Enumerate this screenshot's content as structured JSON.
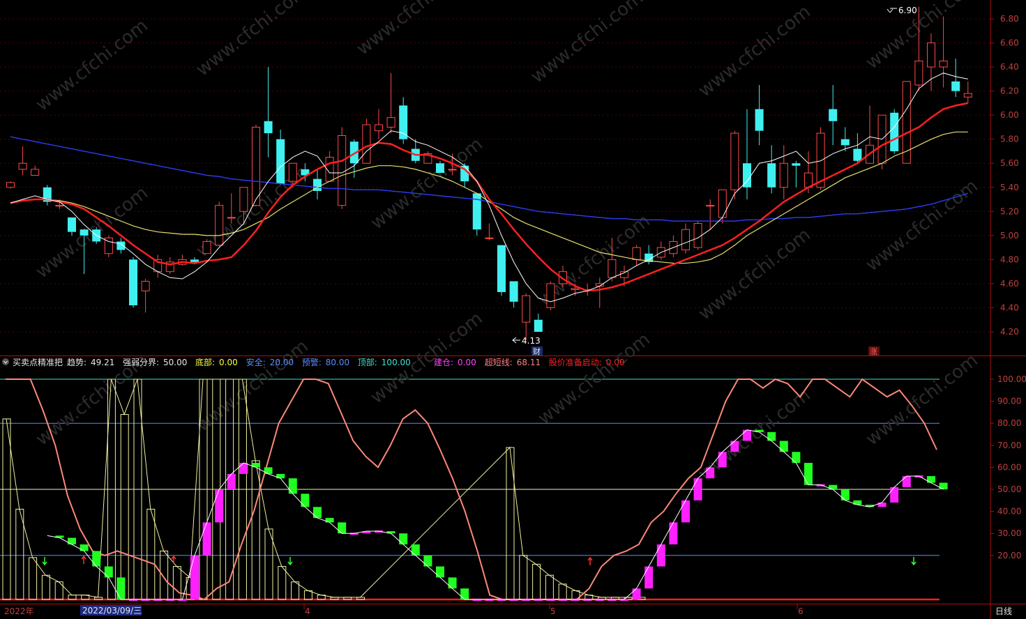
{
  "upper": {
    "y_ticks": [
      "6.80",
      "6.60",
      "6.40",
      "6.20",
      "6.00",
      "5.80",
      "5.60",
      "5.40",
      "5.20",
      "5.00",
      "4.80",
      "4.60",
      "4.40",
      "4.20"
    ],
    "high_label": "6.90",
    "low_label": "4.13",
    "marker_cai": "财",
    "marker_zhang": "涨"
  },
  "indicator": {
    "name": "买卖点精准把",
    "items": [
      {
        "label": "趋势:",
        "value": "49.21",
        "color": "#e8e8e8"
      },
      {
        "label": "强弱分界:",
        "value": "50.00",
        "color": "#e8e8e8"
      },
      {
        "label": "底部:",
        "value": "0.00",
        "color": "#ffff40"
      },
      {
        "label": "安全:",
        "value": "20.00",
        "color": "#5b8cff"
      },
      {
        "label": "预警:",
        "value": "80.00",
        "color": "#5b8cff"
      },
      {
        "label": "顶部:",
        "value": "100.00",
        "color": "#40e0d0"
      },
      {
        "label": "建仓:",
        "value": "0.00",
        "color": "#ff40ff"
      },
      {
        "label": "超短线:",
        "value": "68.11",
        "color": "#ff8080"
      },
      {
        "label": "股价准备启动:",
        "value": "0.00",
        "color": "#ff2020"
      }
    ],
    "y_ticks": [
      "100.00",
      "90.00",
      "80.00",
      "70.00",
      "60.00",
      "50.00",
      "40.00",
      "30.00",
      "20.00"
    ]
  },
  "x_axis": {
    "labels": [
      "2022年",
      "4",
      "5",
      "6"
    ],
    "cursor_date": "2022/03/09/三",
    "period": "日线"
  },
  "chart_data": {
    "type": "candlestick",
    "price_ylim": [
      4.1,
      6.9
    ],
    "indicator_ylim": [
      0,
      100
    ],
    "candles": [
      [
        5.4,
        5.44,
        5.39,
        5.45
      ],
      [
        5.55,
        5.6,
        5.5,
        5.74
      ],
      [
        5.5,
        5.55,
        5.5,
        5.58
      ],
      [
        5.4,
        5.28,
        5.25,
        5.42
      ],
      [
        5.25,
        5.25,
        5.22,
        5.3
      ],
      [
        5.15,
        5.03,
        5.0,
        5.15
      ],
      [
        5.05,
        5.0,
        4.68,
        5.05
      ],
      [
        5.05,
        4.95,
        4.93,
        5.07
      ],
      [
        4.85,
        4.98,
        4.82,
        5.0
      ],
      [
        4.95,
        4.88,
        4.85,
        4.98
      ],
      [
        4.8,
        4.42,
        4.4,
        4.82
      ],
      [
        4.54,
        4.62,
        4.36,
        4.64
      ],
      [
        4.7,
        4.8,
        4.65,
        4.84
      ],
      [
        4.7,
        4.78,
        4.68,
        4.82
      ],
      [
        4.76,
        4.8,
        4.75,
        4.84
      ],
      [
        4.8,
        4.78,
        4.76,
        4.82
      ],
      [
        4.85,
        4.95,
        4.85,
        4.97
      ],
      [
        4.92,
        5.25,
        4.91,
        5.28
      ],
      [
        5.15,
        5.15,
        5.1,
        5.35
      ],
      [
        5.2,
        5.4,
        5.1,
        5.4
      ],
      [
        5.25,
        5.9,
        5.24,
        5.92
      ],
      [
        5.95,
        5.85,
        5.65,
        6.4
      ],
      [
        5.8,
        5.43,
        5.42,
        5.88
      ],
      [
        5.45,
        5.6,
        5.4,
        5.6
      ],
      [
        5.55,
        5.5,
        5.45,
        5.6
      ],
      [
        5.47,
        5.37,
        5.3,
        5.55
      ],
      [
        5.45,
        5.65,
        5.45,
        5.7
      ],
      [
        5.25,
        5.83,
        5.22,
        5.9
      ],
      [
        5.78,
        5.6,
        5.48,
        5.8
      ],
      [
        5.6,
        5.92,
        5.6,
        5.97
      ],
      [
        5.87,
        5.92,
        5.8,
        6.05
      ],
      [
        5.9,
        5.98,
        5.85,
        6.35
      ],
      [
        6.08,
        5.8,
        5.76,
        6.15
      ],
      [
        5.72,
        5.62,
        5.6,
        5.8
      ],
      [
        5.6,
        5.68,
        5.6,
        5.7
      ],
      [
        5.6,
        5.52,
        5.52,
        5.62
      ],
      [
        5.55,
        5.55,
        5.5,
        5.68
      ],
      [
        5.58,
        5.45,
        5.4,
        5.6
      ],
      [
        5.35,
        5.05,
        5.0,
        5.35
      ],
      [
        4.98,
        4.98,
        4.96,
        5.1
      ],
      [
        4.92,
        4.53,
        4.5,
        4.92
      ],
      [
        4.62,
        4.45,
        4.4,
        4.62
      ],
      [
        4.28,
        4.5,
        4.13,
        4.52
      ],
      [
        4.3,
        4.2,
        4.2,
        4.35
      ],
      [
        4.4,
        4.6,
        4.38,
        4.62
      ],
      [
        4.6,
        4.7,
        4.57,
        4.75
      ],
      [
        4.55,
        4.56,
        4.5,
        4.6
      ],
      [
        4.55,
        4.55,
        4.5,
        4.6
      ],
      [
        4.58,
        4.6,
        4.4,
        4.65
      ],
      [
        4.65,
        4.8,
        4.62,
        4.98
      ],
      [
        4.65,
        4.7,
        4.58,
        4.75
      ],
      [
        4.8,
        4.9,
        4.75,
        4.92
      ],
      [
        4.85,
        4.78,
        4.76,
        4.92
      ],
      [
        4.82,
        4.9,
        4.8,
        4.95
      ],
      [
        4.85,
        4.95,
        4.82,
        5.0
      ],
      [
        4.88,
        5.05,
        4.85,
        5.1
      ],
      [
        4.9,
        5.1,
        4.88,
        5.12
      ],
      [
        5.25,
        5.25,
        5.05,
        5.3
      ],
      [
        5.15,
        5.38,
        5.1,
        5.38
      ],
      [
        5.38,
        5.85,
        5.3,
        5.87
      ],
      [
        5.6,
        5.4,
        5.3,
        6.05
      ],
      [
        6.05,
        5.87,
        5.75,
        6.25
      ],
      [
        5.6,
        5.4,
        5.35,
        5.75
      ],
      [
        5.4,
        5.6,
        5.3,
        5.75
      ],
      [
        5.6,
        5.58,
        5.4,
        5.62
      ],
      [
        5.4,
        5.52,
        5.35,
        5.7
      ],
      [
        5.4,
        5.85,
        5.38,
        5.9
      ],
      [
        6.05,
        5.95,
        5.75,
        6.25
      ],
      [
        5.8,
        5.75,
        5.7,
        5.9
      ],
      [
        5.72,
        5.62,
        5.6,
        5.85
      ],
      [
        5.6,
        5.75,
        5.6,
        6.08
      ],
      [
        5.6,
        6.0,
        5.55,
        6.0
      ],
      [
        6.02,
        5.7,
        5.68,
        6.05
      ],
      [
        5.6,
        6.28,
        5.6,
        6.28
      ],
      [
        6.25,
        6.45,
        6.2,
        6.9
      ],
      [
        6.4,
        6.6,
        6.2,
        6.68
      ],
      [
        6.4,
        6.45,
        6.23,
        6.82
      ],
      [
        6.28,
        6.2,
        6.15,
        6.47
      ],
      [
        6.15,
        6.18,
        6.1,
        6.28
      ]
    ],
    "ma_short": [
      5.27,
      5.3,
      5.33,
      5.3,
      5.28,
      5.2,
      5.09,
      5.0,
      4.95,
      4.93,
      4.85,
      4.76,
      4.7,
      4.65,
      4.64,
      4.7,
      4.78,
      4.9,
      5.0,
      5.1,
      5.3,
      5.45,
      5.57,
      5.65,
      5.7,
      5.66,
      5.52,
      5.52,
      5.58,
      5.7,
      5.78,
      5.87,
      5.85,
      5.78,
      5.75,
      5.7,
      5.65,
      5.58,
      5.45,
      5.25,
      5.0,
      4.78,
      4.6,
      4.48,
      4.45,
      4.48,
      4.52,
      4.54,
      4.58,
      4.65,
      4.69,
      4.75,
      4.8,
      4.86,
      4.9,
      4.94,
      4.98,
      5.05,
      5.15,
      5.35,
      5.45,
      5.6,
      5.62,
      5.66,
      5.7,
      5.6,
      5.62,
      5.68,
      5.72,
      5.75,
      5.82,
      5.8,
      5.9,
      6.05,
      6.22,
      6.3,
      6.35,
      6.32,
      6.3
    ],
    "ma_mid": [
      5.27,
      5.29,
      5.3,
      5.3,
      5.28,
      5.26,
      5.22,
      5.15,
      5.08,
      5.0,
      4.92,
      4.85,
      4.78,
      4.76,
      4.78,
      4.77,
      4.79,
      4.8,
      4.82,
      4.92,
      5.04,
      5.19,
      5.32,
      5.42,
      5.49,
      5.55,
      5.6,
      5.62,
      5.68,
      5.74,
      5.77,
      5.76,
      5.71,
      5.67,
      5.67,
      5.64,
      5.6,
      5.55,
      5.45,
      5.3,
      5.18,
      5.05,
      4.93,
      4.82,
      4.72,
      4.64,
      4.58,
      4.54,
      4.55,
      4.57,
      4.6,
      4.64,
      4.68,
      4.72,
      4.76,
      4.8,
      4.84,
      4.88,
      4.92,
      4.98,
      5.05,
      5.12,
      5.2,
      5.28,
      5.34,
      5.4,
      5.45,
      5.5,
      5.55,
      5.6,
      5.68,
      5.75,
      5.8,
      5.85,
      5.9,
      5.98,
      6.05,
      6.08,
      6.1
    ],
    "ma_long": [
      5.27,
      5.29,
      5.3,
      5.3,
      5.29,
      5.27,
      5.24,
      5.2,
      5.16,
      5.12,
      5.08,
      5.05,
      5.03,
      5.02,
      5.01,
      5.01,
      5.0,
      5.0,
      5.02,
      5.05,
      5.1,
      5.15,
      5.22,
      5.28,
      5.34,
      5.4,
      5.45,
      5.5,
      5.53,
      5.56,
      5.58,
      5.58,
      5.57,
      5.55,
      5.52,
      5.49,
      5.45,
      5.4,
      5.35,
      5.28,
      5.22,
      5.15,
      5.1,
      5.06,
      5.02,
      4.98,
      4.94,
      4.9,
      4.86,
      4.84,
      4.82,
      4.8,
      4.79,
      4.78,
      4.77,
      4.77,
      4.78,
      4.8,
      4.85,
      4.92,
      5.0,
      5.06,
      5.12,
      5.18,
      5.24,
      5.3,
      5.36,
      5.42,
      5.48,
      5.52,
      5.56,
      5.6,
      5.66,
      5.7,
      5.75,
      5.8,
      5.84,
      5.86,
      5.86
    ],
    "ma_trend": [
      5.82,
      5.8,
      5.78,
      5.76,
      5.74,
      5.72,
      5.7,
      5.68,
      5.66,
      5.64,
      5.62,
      5.6,
      5.58,
      5.56,
      5.54,
      5.52,
      5.5,
      5.49,
      5.47,
      5.46,
      5.45,
      5.44,
      5.43,
      5.42,
      5.41,
      5.4,
      5.39,
      5.39,
      5.38,
      5.38,
      5.38,
      5.37,
      5.36,
      5.35,
      5.34,
      5.33,
      5.32,
      5.31,
      5.3,
      5.28,
      5.26,
      5.24,
      5.22,
      5.2,
      5.19,
      5.18,
      5.17,
      5.16,
      5.15,
      5.14,
      5.14,
      5.13,
      5.13,
      5.13,
      5.12,
      5.12,
      5.12,
      5.12,
      5.12,
      5.12,
      5.13,
      5.13,
      5.14,
      5.14,
      5.15,
      5.15,
      5.16,
      5.17,
      5.18,
      5.18,
      5.19,
      5.2,
      5.21,
      5.22,
      5.24,
      5.26,
      5.29,
      5.32,
      5.35
    ],
    "trend": [
      null,
      29,
      28,
      25,
      22,
      15,
      10,
      0,
      0,
      0,
      0,
      0,
      0,
      20,
      35,
      50,
      57,
      62,
      60,
      57,
      55,
      48,
      42,
      37,
      35,
      30,
      30,
      31,
      31,
      30,
      25,
      20,
      15,
      10,
      5,
      0,
      0,
      0,
      0,
      0,
      0,
      0,
      0,
      0,
      0,
      0,
      0,
      0,
      0,
      5,
      15,
      25,
      35,
      45,
      55,
      60,
      67,
      72,
      77,
      76,
      72,
      67,
      62,
      52,
      52,
      50,
      45,
      43,
      42,
      44,
      51,
      56,
      56,
      53,
      50
    ],
    "trend_x_start": 2,
    "super_short": [
      100,
      100,
      100,
      86,
      70,
      47,
      32,
      22,
      20,
      22,
      20,
      18,
      16,
      8,
      3,
      2,
      0,
      5,
      8,
      25,
      40,
      60,
      80,
      90,
      100,
      100,
      98,
      85,
      72,
      65,
      60,
      70,
      82,
      86,
      80,
      68,
      55,
      40,
      22,
      2,
      0,
      0,
      0,
      0,
      0,
      0,
      0,
      5,
      15,
      20,
      22,
      25,
      35,
      40,
      48,
      55,
      60,
      75,
      90,
      100,
      100,
      96,
      100,
      98,
      92,
      100,
      100,
      96,
      92,
      100,
      96,
      92,
      95,
      88,
      80,
      68
    ],
    "bottom_bars": [
      82,
      41,
      19,
      11,
      8,
      2,
      2,
      1,
      100,
      84,
      100,
      41,
      22,
      15,
      10,
      100,
      100,
      100,
      100,
      63,
      32,
      15,
      8,
      4,
      2,
      1,
      1,
      1,
      69,
      20,
      16,
      11,
      7,
      4,
      2,
      1,
      1,
      1,
      1
    ]
  }
}
